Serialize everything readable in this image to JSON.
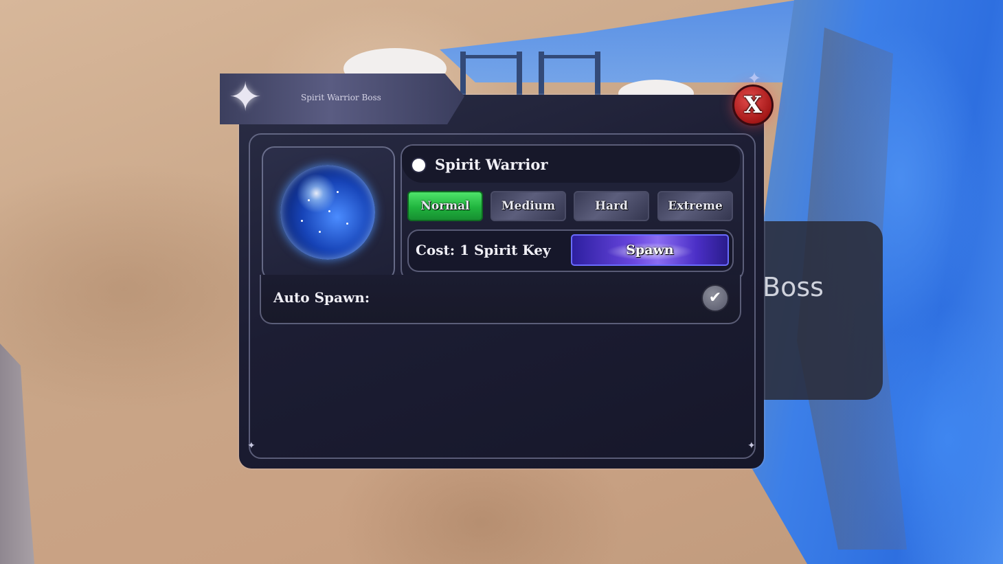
{
  "window": {
    "title": "Spirit Warrior Boss",
    "close_label": "X"
  },
  "boss": {
    "name": "Spirit Warrior",
    "selected": true
  },
  "difficulties": [
    {
      "label": "Normal",
      "active": true
    },
    {
      "label": "Medium",
      "active": false
    },
    {
      "label": "Hard",
      "active": false
    },
    {
      "label": "Extreme",
      "active": false
    }
  ],
  "cost": {
    "text": "Cost: 1 Spirit Key"
  },
  "spawn": {
    "label": "Spawn"
  },
  "auto_spawn": {
    "label": "Auto Spawn:",
    "checked": true,
    "icon": "checkmark-icon",
    "glyph": "✔"
  },
  "background_card": {
    "label": "Boss"
  },
  "colors": {
    "active_difficulty": "#20b43e",
    "spawn_button": "#6a47e0",
    "close_button": "#a51818",
    "panel": "#1c1d33"
  }
}
